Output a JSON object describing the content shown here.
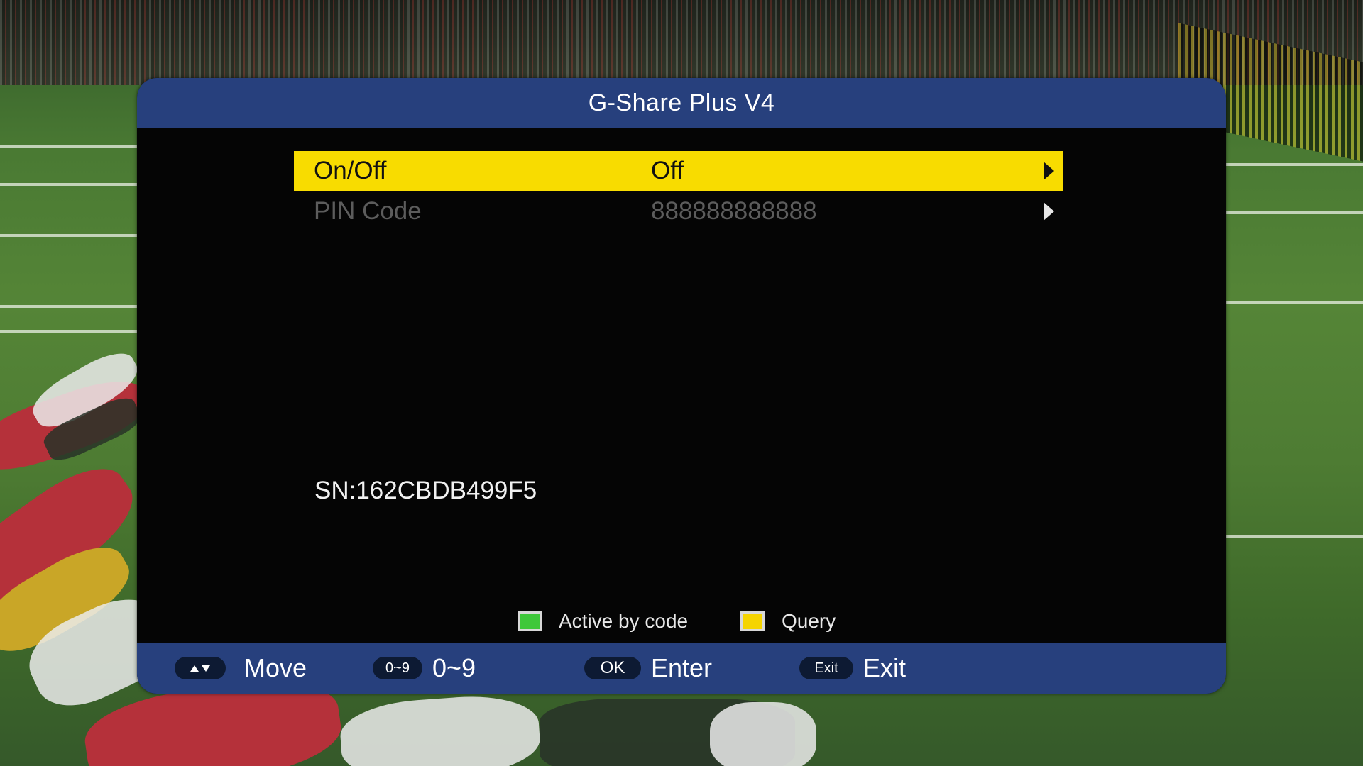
{
  "dialog": {
    "title": "G-Share Plus V4"
  },
  "menu": {
    "rows": [
      {
        "label": "On/Off",
        "value": "Off",
        "selected": true
      },
      {
        "label": "PIN Code",
        "value": "888888888888",
        "selected": false
      }
    ]
  },
  "serial": "SN:162CBDB499F5",
  "legend": [
    {
      "label": "Active by code",
      "color": "#3ec83a"
    },
    {
      "label": "Query",
      "color": "#f5d400"
    }
  ],
  "footer": {
    "hints": [
      {
        "key_icon": "up-down-arrows-icon",
        "key": "",
        "label": "Move"
      },
      {
        "key_icon": "",
        "key": "0~9",
        "label": "0~9"
      },
      {
        "key_icon": "",
        "key": "OK",
        "label": "Enter"
      },
      {
        "key_icon": "",
        "key": "Exit",
        "label": "Exit"
      }
    ]
  },
  "colors": {
    "header": "#27407d",
    "selection": "#f8dc00",
    "panel": "#050505"
  }
}
